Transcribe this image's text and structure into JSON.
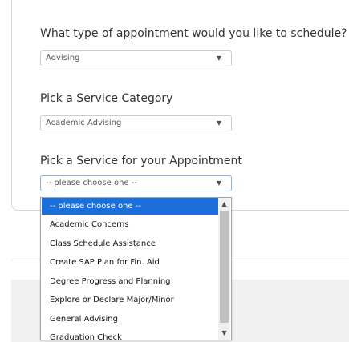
{
  "form": {
    "appointment_type": {
      "label": "What type of appointment would you like to schedule?",
      "value": "Advising"
    },
    "service_category": {
      "label": "Pick a Service Category",
      "value": "Academic Advising"
    },
    "service": {
      "label": "Pick a Service for your Appointment",
      "value": "-- please choose one --",
      "options": [
        "-- please choose one --",
        "Academic Concerns",
        "Class Schedule Assistance",
        "Create SAP Plan for Fin. Aid",
        "Degree Progress and Planning",
        "Explore or Declare Major/Minor",
        "General Advising",
        "Graduation Check"
      ]
    }
  },
  "icons": {
    "caret": "chevron-down-icon",
    "scroll_up": "scroll-up-arrow-icon",
    "scroll_down": "scroll-down-arrow-icon"
  },
  "colors": {
    "selected_option_bg": "#1c6ed8",
    "focus_border": "#8ab0e6"
  }
}
